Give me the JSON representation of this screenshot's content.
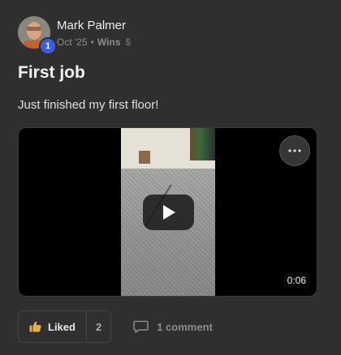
{
  "post": {
    "author": "Mark Palmer",
    "level": "1",
    "date": "Oct '25",
    "separator": "•",
    "category": "Wins",
    "title": "First job",
    "body": "Just finished my first floor!"
  },
  "video": {
    "duration": "0:06"
  },
  "actions": {
    "like_label": "Liked",
    "like_count": "2",
    "comment_label": "1 comment"
  },
  "icons": {
    "dollar": "$"
  },
  "colors": {
    "level_badge": "#3d5fd6",
    "background": "#2f2f2f",
    "like_icon": "#e8b04a"
  }
}
